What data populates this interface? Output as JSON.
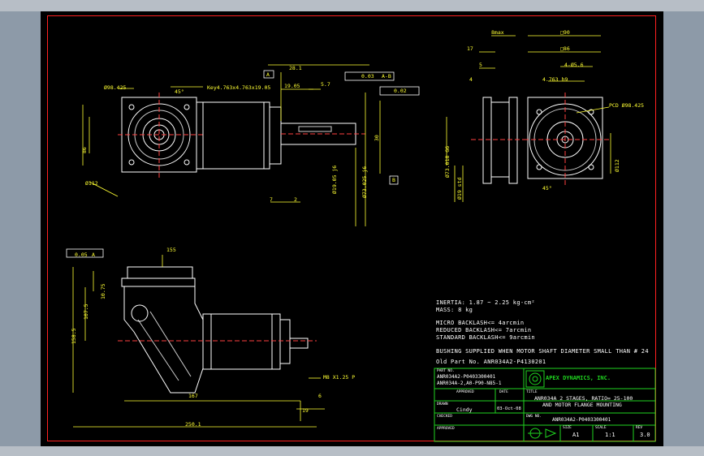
{
  "drawing": {
    "notes": {
      "inertia": "INERTIA: 1.87 ~ 2.25 kg-cm²",
      "mass": "MASS: 8 kg",
      "micro_backlash": "MICRO BACKLASH<= 4arcmin",
      "reduced_backlash": "REDUCED BACKLASH<= 7arcmin",
      "standard_backlash": "STANDARD BACKLASH<= 9arcmin",
      "bushing": "BUSHING SUPPLIED WHEN MOTOR SHAFT DIAMETER SMALL THAN # 24",
      "old_part": "Old Part No. ANR034A2-P4130201"
    },
    "dimensions": {
      "d_98_425": "Ø98.425",
      "angle_45": "45°",
      "key": "Key4.763x4.763x19.05",
      "d_28_1": "28.1",
      "d_19_05": "19.05",
      "d_5_7": "5.7",
      "tol_003": "0.03",
      "tol_ab": "A-B",
      "tol_002": "0.02",
      "datum_a": "A",
      "datum_b": "B",
      "d_7": "7",
      "d_2": "2",
      "d_19_05j6": "Ø19.05 j6",
      "d_73_025j6": "Ø73.025 j6",
      "d_30": "30",
      "d_112": "Ø112",
      "d_86": "86",
      "d_90": "□90",
      "d_86sq": "□86",
      "d_8max": "8max",
      "d_17": "17",
      "d_5": "5",
      "d_4": "4",
      "d_4_5_6": "4-Ø5.6",
      "d_4_763_h9": "4.763 h9",
      "pcd": "PCD Ø98.425",
      "d_73_018": "Ø73.018 G6",
      "d_19_std": "Ø19 std",
      "d_112b": "Ø112",
      "d_155": "155",
      "d_107_5": "107.5",
      "d_158_5": "158.5",
      "d_10_75": "10.75",
      "d_167": "167",
      "d_6": "6",
      "d_19": "19",
      "d_250": "250.1",
      "d_005": "0.05",
      "m8": "M8 X1.25 P"
    },
    "title_block": {
      "part_no_label": "PART NO.",
      "part_no_1": "ANR034A2-P0403300401",
      "part_no_2": "ANR034A-2,A0-P90-N85-1",
      "company": "APEX DYNAMICS, INC.",
      "approved_label": "APPROVED",
      "date_label": "DATE",
      "title_label": "TITLE",
      "title_line1": "ANR034A 2 STAGES, RATIO= 25-100",
      "title_line2": "AND MOTOR FLANGE MOUNTING",
      "drawn_label": "DRAWN",
      "drawn_by": "Cindy",
      "drawn_date": "03-Oct-08",
      "checked_label": "CHECKED",
      "dwg_label": "DWG NO.",
      "dwg_no": "ANR034A2-P0403300401",
      "approved2_label": "APPROVED",
      "size_label": "SIZE",
      "size": "A1",
      "scale_label": "SCALE",
      "scale": "1:1",
      "rev_label": "REV",
      "rev": "3.0"
    }
  }
}
